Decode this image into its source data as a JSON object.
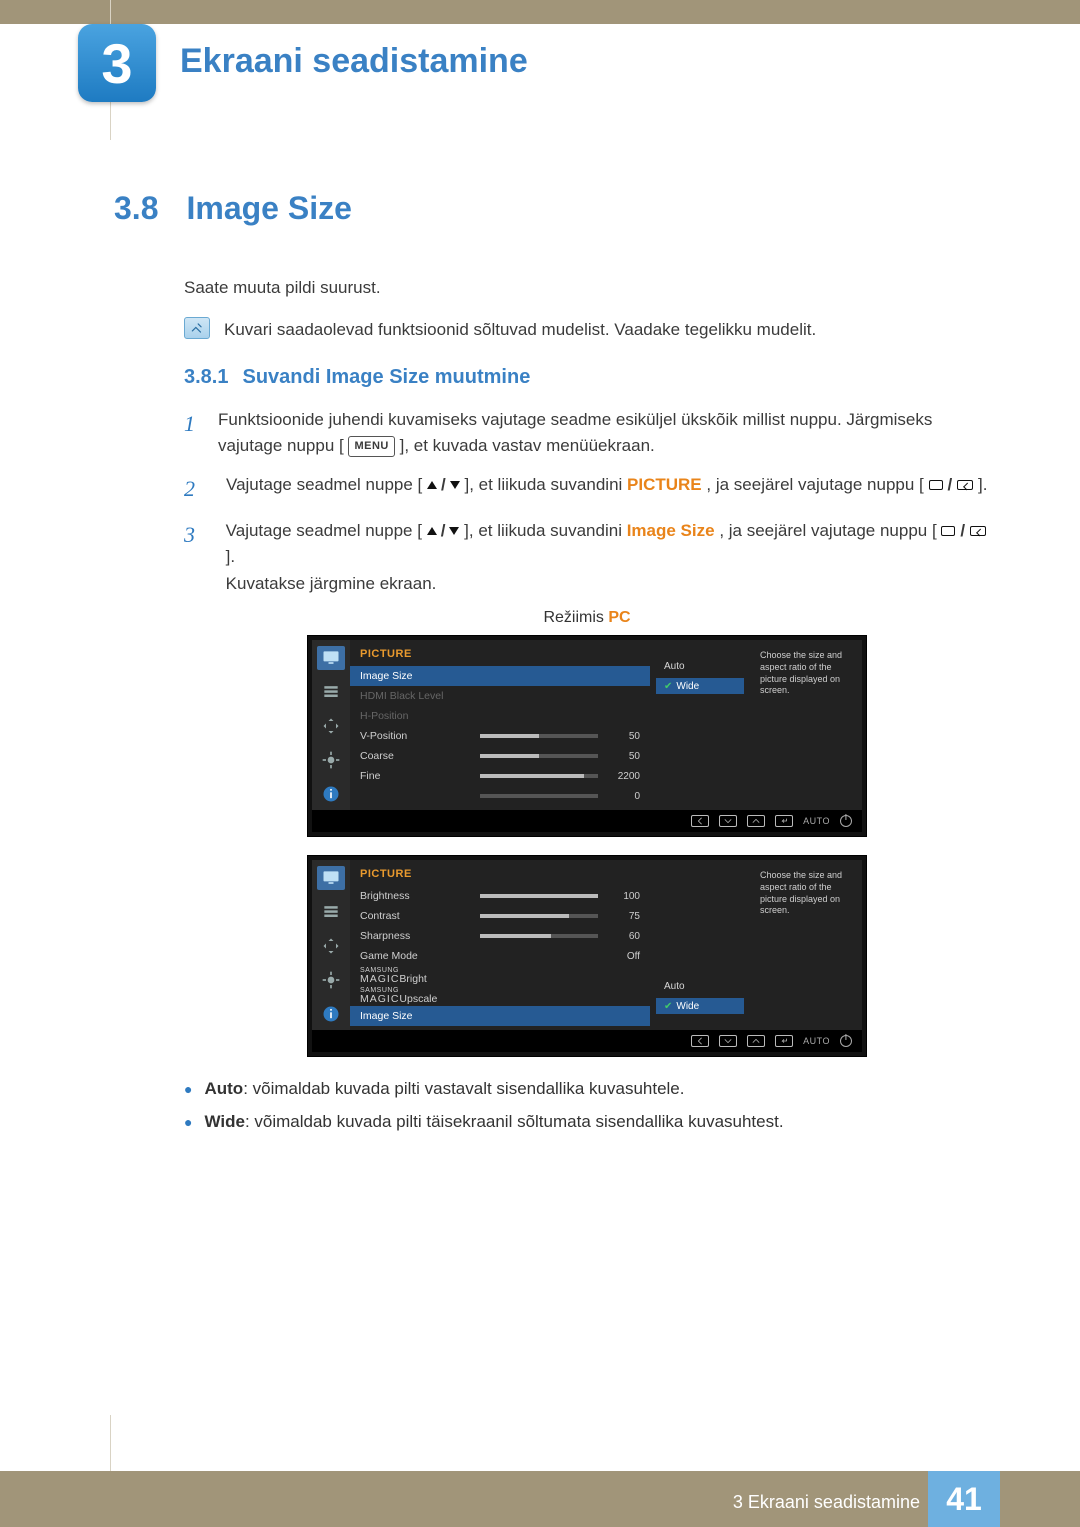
{
  "chapter": {
    "number": "3",
    "title": "Ekraani seadistamine"
  },
  "section": {
    "number": "3.8",
    "title": "Image Size"
  },
  "intro": "Saate muuta pildi suurust.",
  "note": "Kuvari saadaolevad funktsioonid sõltuvad mudelist. Vaadake tegelikku mudelit.",
  "subsection": {
    "number": "3.8.1",
    "title": "Suvandi Image Size muutmine"
  },
  "steps": {
    "s1a": "Funktsioonide juhendi kuvamiseks vajutage seadme esiküljel ükskõik millist nuppu. Järgmiseks vajutage nuppu [",
    "s1_menu": "MENU",
    "s1b": "], et kuvada vastav menüüekraan.",
    "s2a": "Vajutage seadmel nuppe [",
    "s2b": "], et liikuda suvandini ",
    "s2_target": "PICTURE",
    "s2c": ", ja seejärel vajutage nuppu [",
    "s2d": "].",
    "s3a": "Vajutage seadmel nuppe [",
    "s3b": "], et liikuda suvandini ",
    "s3_target": "Image Size",
    "s3c": ", ja seejärel vajutage nuppu [",
    "s3d": "].",
    "s3e": "Kuvatakse järgmine ekraan."
  },
  "mode": {
    "prefix": "Režiimis ",
    "value": "PC"
  },
  "osd": {
    "title": "PICTURE",
    "tooltip": "Choose the size and aspect ratio of the picture displayed on screen.",
    "options": {
      "auto": "Auto",
      "wide": "Wide"
    },
    "footer_auto": "AUTO",
    "panel1": {
      "rows": [
        {
          "label": "Image Size",
          "type": "sel"
        },
        {
          "label": "HDMI Black Level",
          "type": "dis"
        },
        {
          "label": "H-Position",
          "type": "dis-plain"
        },
        {
          "label": "V-Position",
          "type": "bar",
          "value": "50",
          "pct": 50
        },
        {
          "label": "Coarse",
          "type": "bar",
          "value": "50",
          "pct": 50
        },
        {
          "label": "Fine",
          "type": "bar",
          "value": "2200",
          "pct": 88
        },
        {
          "label": "",
          "type": "bar",
          "value": "0",
          "pct": 0
        }
      ]
    },
    "panel2": {
      "rows": [
        {
          "label": "Brightness",
          "type": "bar",
          "value": "100",
          "pct": 100
        },
        {
          "label": "Contrast",
          "type": "bar",
          "value": "75",
          "pct": 75
        },
        {
          "label": "Sharpness",
          "type": "bar",
          "value": "60",
          "pct": 60
        },
        {
          "label": "Game Mode",
          "type": "text",
          "value": "Off"
        },
        {
          "label": "MAGICBright",
          "type": "magic"
        },
        {
          "label": "MAGICUpscale",
          "type": "magic"
        },
        {
          "label": "Image Size",
          "type": "sel"
        }
      ]
    }
  },
  "bullets": {
    "auto_label": "Auto",
    "auto_text": ": võimaldab kuvada pilti vastavalt sisendallika kuvasuhtele.",
    "wide_label": "Wide",
    "wide_text": ": võimaldab kuvada pilti täisekraanil sõltumata sisendallika kuvasuhtest."
  },
  "footer": {
    "chapter_line": "3 Ekraani seadistamine",
    "page": "41"
  }
}
